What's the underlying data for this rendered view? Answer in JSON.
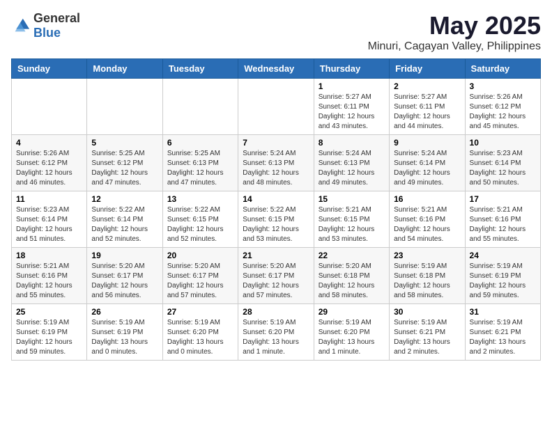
{
  "header": {
    "logo_general": "General",
    "logo_blue": "Blue",
    "title": "May 2025",
    "subtitle": "Minuri, Cagayan Valley, Philippines"
  },
  "calendar": {
    "days_of_week": [
      "Sunday",
      "Monday",
      "Tuesday",
      "Wednesday",
      "Thursday",
      "Friday",
      "Saturday"
    ],
    "weeks": [
      {
        "days": [
          {
            "num": "",
            "info": ""
          },
          {
            "num": "",
            "info": ""
          },
          {
            "num": "",
            "info": ""
          },
          {
            "num": "",
            "info": ""
          },
          {
            "num": "1",
            "info": "Sunrise: 5:27 AM\nSunset: 6:11 PM\nDaylight: 12 hours\nand 43 minutes."
          },
          {
            "num": "2",
            "info": "Sunrise: 5:27 AM\nSunset: 6:11 PM\nDaylight: 12 hours\nand 44 minutes."
          },
          {
            "num": "3",
            "info": "Sunrise: 5:26 AM\nSunset: 6:12 PM\nDaylight: 12 hours\nand 45 minutes."
          }
        ]
      },
      {
        "days": [
          {
            "num": "4",
            "info": "Sunrise: 5:26 AM\nSunset: 6:12 PM\nDaylight: 12 hours\nand 46 minutes."
          },
          {
            "num": "5",
            "info": "Sunrise: 5:25 AM\nSunset: 6:12 PM\nDaylight: 12 hours\nand 47 minutes."
          },
          {
            "num": "6",
            "info": "Sunrise: 5:25 AM\nSunset: 6:13 PM\nDaylight: 12 hours\nand 47 minutes."
          },
          {
            "num": "7",
            "info": "Sunrise: 5:24 AM\nSunset: 6:13 PM\nDaylight: 12 hours\nand 48 minutes."
          },
          {
            "num": "8",
            "info": "Sunrise: 5:24 AM\nSunset: 6:13 PM\nDaylight: 12 hours\nand 49 minutes."
          },
          {
            "num": "9",
            "info": "Sunrise: 5:24 AM\nSunset: 6:14 PM\nDaylight: 12 hours\nand 49 minutes."
          },
          {
            "num": "10",
            "info": "Sunrise: 5:23 AM\nSunset: 6:14 PM\nDaylight: 12 hours\nand 50 minutes."
          }
        ]
      },
      {
        "days": [
          {
            "num": "11",
            "info": "Sunrise: 5:23 AM\nSunset: 6:14 PM\nDaylight: 12 hours\nand 51 minutes."
          },
          {
            "num": "12",
            "info": "Sunrise: 5:22 AM\nSunset: 6:14 PM\nDaylight: 12 hours\nand 52 minutes."
          },
          {
            "num": "13",
            "info": "Sunrise: 5:22 AM\nSunset: 6:15 PM\nDaylight: 12 hours\nand 52 minutes."
          },
          {
            "num": "14",
            "info": "Sunrise: 5:22 AM\nSunset: 6:15 PM\nDaylight: 12 hours\nand 53 minutes."
          },
          {
            "num": "15",
            "info": "Sunrise: 5:21 AM\nSunset: 6:15 PM\nDaylight: 12 hours\nand 53 minutes."
          },
          {
            "num": "16",
            "info": "Sunrise: 5:21 AM\nSunset: 6:16 PM\nDaylight: 12 hours\nand 54 minutes."
          },
          {
            "num": "17",
            "info": "Sunrise: 5:21 AM\nSunset: 6:16 PM\nDaylight: 12 hours\nand 55 minutes."
          }
        ]
      },
      {
        "days": [
          {
            "num": "18",
            "info": "Sunrise: 5:21 AM\nSunset: 6:16 PM\nDaylight: 12 hours\nand 55 minutes."
          },
          {
            "num": "19",
            "info": "Sunrise: 5:20 AM\nSunset: 6:17 PM\nDaylight: 12 hours\nand 56 minutes."
          },
          {
            "num": "20",
            "info": "Sunrise: 5:20 AM\nSunset: 6:17 PM\nDaylight: 12 hours\nand 57 minutes."
          },
          {
            "num": "21",
            "info": "Sunrise: 5:20 AM\nSunset: 6:17 PM\nDaylight: 12 hours\nand 57 minutes."
          },
          {
            "num": "22",
            "info": "Sunrise: 5:20 AM\nSunset: 6:18 PM\nDaylight: 12 hours\nand 58 minutes."
          },
          {
            "num": "23",
            "info": "Sunrise: 5:19 AM\nSunset: 6:18 PM\nDaylight: 12 hours\nand 58 minutes."
          },
          {
            "num": "24",
            "info": "Sunrise: 5:19 AM\nSunset: 6:19 PM\nDaylight: 12 hours\nand 59 minutes."
          }
        ]
      },
      {
        "days": [
          {
            "num": "25",
            "info": "Sunrise: 5:19 AM\nSunset: 6:19 PM\nDaylight: 12 hours\nand 59 minutes."
          },
          {
            "num": "26",
            "info": "Sunrise: 5:19 AM\nSunset: 6:19 PM\nDaylight: 13 hours\nand 0 minutes."
          },
          {
            "num": "27",
            "info": "Sunrise: 5:19 AM\nSunset: 6:20 PM\nDaylight: 13 hours\nand 0 minutes."
          },
          {
            "num": "28",
            "info": "Sunrise: 5:19 AM\nSunset: 6:20 PM\nDaylight: 13 hours\nand 1 minute."
          },
          {
            "num": "29",
            "info": "Sunrise: 5:19 AM\nSunset: 6:20 PM\nDaylight: 13 hours\nand 1 minute."
          },
          {
            "num": "30",
            "info": "Sunrise: 5:19 AM\nSunset: 6:21 PM\nDaylight: 13 hours\nand 2 minutes."
          },
          {
            "num": "31",
            "info": "Sunrise: 5:19 AM\nSunset: 6:21 PM\nDaylight: 13 hours\nand 2 minutes."
          }
        ]
      }
    ]
  }
}
